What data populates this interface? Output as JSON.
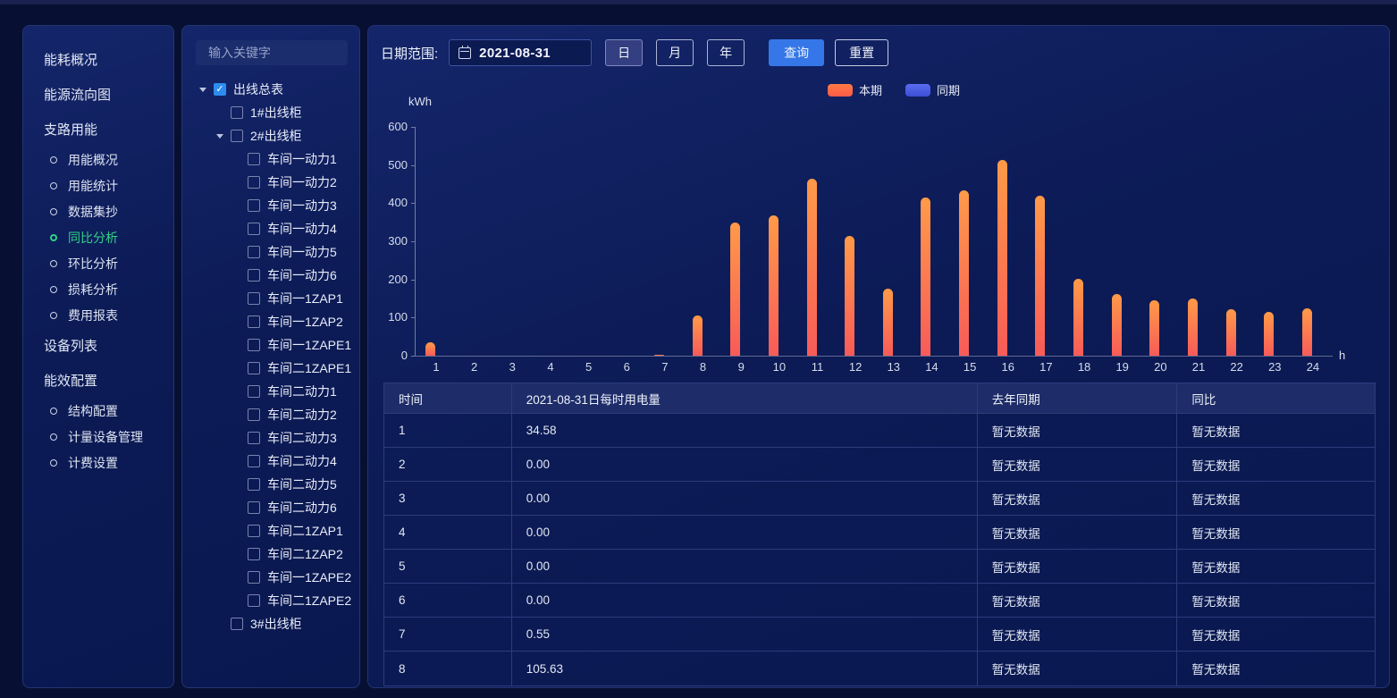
{
  "sidebar": {
    "items": [
      {
        "label": "能耗概况",
        "type": "group",
        "active": false
      },
      {
        "label": "能源流向图",
        "type": "group",
        "active": false
      },
      {
        "label": "支路用能",
        "type": "group",
        "active": false
      },
      {
        "label": "用能概况",
        "type": "sub",
        "active": false
      },
      {
        "label": "用能统计",
        "type": "sub",
        "active": false
      },
      {
        "label": "数据集抄",
        "type": "sub",
        "active": false
      },
      {
        "label": "同比分析",
        "type": "sub",
        "active": true
      },
      {
        "label": "环比分析",
        "type": "sub",
        "active": false
      },
      {
        "label": "损耗分析",
        "type": "sub",
        "active": false
      },
      {
        "label": "费用报表",
        "type": "sub",
        "active": false
      },
      {
        "label": "设备列表",
        "type": "group",
        "active": false
      },
      {
        "label": "能效配置",
        "type": "group",
        "active": false
      },
      {
        "label": "结构配置",
        "type": "sub",
        "active": false
      },
      {
        "label": "计量设备管理",
        "type": "sub",
        "active": false
      },
      {
        "label": "计费设置",
        "type": "sub",
        "active": false
      }
    ]
  },
  "tree": {
    "search_placeholder": "输入关键字",
    "nodes": [
      {
        "label": "出线总表",
        "level": 0,
        "caret": true,
        "checked": true
      },
      {
        "label": "1#出线柜",
        "level": 1,
        "caret": false,
        "checked": false
      },
      {
        "label": "2#出线柜",
        "level": 1,
        "caret": true,
        "checked": false
      },
      {
        "label": "车间一动力1",
        "level": 2,
        "caret": false,
        "checked": false
      },
      {
        "label": "车间一动力2",
        "level": 2,
        "caret": false,
        "checked": false
      },
      {
        "label": "车间一动力3",
        "level": 2,
        "caret": false,
        "checked": false
      },
      {
        "label": "车间一动力4",
        "level": 2,
        "caret": false,
        "checked": false
      },
      {
        "label": "车间一动力5",
        "level": 2,
        "caret": false,
        "checked": false
      },
      {
        "label": "车间一动力6",
        "level": 2,
        "caret": false,
        "checked": false
      },
      {
        "label": "车间一1ZAP1",
        "level": 2,
        "caret": false,
        "checked": false
      },
      {
        "label": "车间一1ZAP2",
        "level": 2,
        "caret": false,
        "checked": false
      },
      {
        "label": "车间一1ZAPE1",
        "level": 2,
        "caret": false,
        "checked": false
      },
      {
        "label": "车间二1ZAPE1",
        "level": 2,
        "caret": false,
        "checked": false
      },
      {
        "label": "车间二动力1",
        "level": 2,
        "caret": false,
        "checked": false
      },
      {
        "label": "车间二动力2",
        "level": 2,
        "caret": false,
        "checked": false
      },
      {
        "label": "车间二动力3",
        "level": 2,
        "caret": false,
        "checked": false
      },
      {
        "label": "车间二动力4",
        "level": 2,
        "caret": false,
        "checked": false
      },
      {
        "label": "车间二动力5",
        "level": 2,
        "caret": false,
        "checked": false
      },
      {
        "label": "车间二动力6",
        "level": 2,
        "caret": false,
        "checked": false
      },
      {
        "label": "车间二1ZAP1",
        "level": 2,
        "caret": false,
        "checked": false
      },
      {
        "label": "车间二1ZAP2",
        "level": 2,
        "caret": false,
        "checked": false
      },
      {
        "label": "车间一1ZAPE2",
        "level": 2,
        "caret": false,
        "checked": false
      },
      {
        "label": "车间二1ZAPE2",
        "level": 2,
        "caret": false,
        "checked": false
      },
      {
        "label": "3#出线柜",
        "level": 1,
        "caret": false,
        "checked": false
      }
    ]
  },
  "toolbar": {
    "date_label": "日期范围:",
    "date_value": "2021-08-31",
    "periods": [
      "日",
      "月",
      "年"
    ],
    "active_period": "日",
    "query_label": "查询",
    "reset_label": "重置"
  },
  "legend": [
    {
      "label": "本期",
      "color_top": "#ff7a44",
      "color_bottom": "#fb5a47"
    },
    {
      "label": "同期",
      "color_top": "#5a6cee",
      "color_bottom": "#3b4ed6"
    }
  ],
  "chart_data": {
    "type": "bar",
    "title": "2021-08-31日每时用电量",
    "ylabel": "kWh",
    "xlabel": "h",
    "ylim": [
      0,
      600
    ],
    "yticks": [
      0,
      100,
      200,
      300,
      400,
      500,
      600
    ],
    "grid": false,
    "legend_position": "top-right",
    "categories": [
      1,
      2,
      3,
      4,
      5,
      6,
      7,
      8,
      9,
      10,
      11,
      12,
      13,
      14,
      15,
      16,
      17,
      18,
      19,
      20,
      21,
      22,
      23,
      24
    ],
    "series": [
      {
        "name": "本期",
        "color": "#fb6a4e",
        "values": [
          34.58,
          0,
          0,
          0,
          0,
          0,
          0.55,
          105.63,
          350,
          368,
          465,
          315,
          175,
          415,
          433,
          513,
          419,
          202,
          162,
          145,
          150,
          122,
          115,
          124
        ]
      },
      {
        "name": "同期",
        "color": "#4c5ce0",
        "values": []
      }
    ]
  },
  "table": {
    "columns": [
      "时间",
      "2021-08-31日每时用电量",
      "去年同期",
      "同比"
    ],
    "rows": [
      [
        "1",
        "34.58",
        "暂无数据",
        "暂无数据"
      ],
      [
        "2",
        "0.00",
        "暂无数据",
        "暂无数据"
      ],
      [
        "3",
        "0.00",
        "暂无数据",
        "暂无数据"
      ],
      [
        "4",
        "0.00",
        "暂无数据",
        "暂无数据"
      ],
      [
        "5",
        "0.00",
        "暂无数据",
        "暂无数据"
      ],
      [
        "6",
        "0.00",
        "暂无数据",
        "暂无数据"
      ],
      [
        "7",
        "0.55",
        "暂无数据",
        "暂无数据"
      ],
      [
        "8",
        "105.63",
        "暂无数据",
        "暂无数据"
      ]
    ]
  },
  "colors": {
    "accent_blue": "#3577e8",
    "active_green": "#2fd287",
    "checkbox_blue": "#2d8cf0",
    "bar_gradient_top": "#ff9a48",
    "bar_gradient_bottom": "#f85b58",
    "panel_bg": "#0c1b56",
    "page_bg": "#071033"
  }
}
